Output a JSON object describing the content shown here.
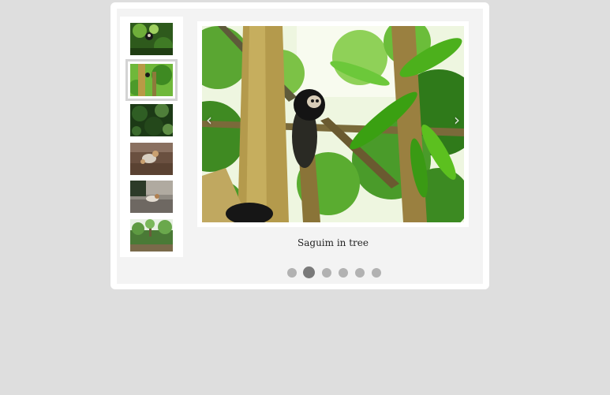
{
  "gallery": {
    "caption": "Saguim in tree",
    "active_index": 1,
    "prev_arrow": "‹",
    "next_arrow": "›",
    "thumbnails": [
      {
        "icon": "monkey-photo"
      },
      {
        "icon": "tree-monkey-photo"
      },
      {
        "icon": "foliage-photo"
      },
      {
        "icon": "dog-photo"
      },
      {
        "icon": "interior-photo"
      },
      {
        "icon": "landscape-photo"
      }
    ],
    "dot_count": 6
  },
  "colors": {
    "page_bg": "#dedede",
    "frame_bg": "#ffffff",
    "inner_bg": "#f3f3f3",
    "dot": "#b2b2b2",
    "dot_active": "#7a7a7a"
  }
}
